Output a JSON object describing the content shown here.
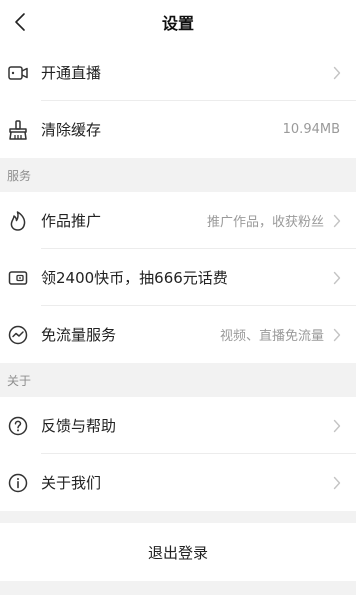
{
  "header": {
    "title": "设置",
    "back_icon": "chevron-left-icon"
  },
  "group_top": [
    {
      "label": "开通直播",
      "icon": "video-camera-icon",
      "value": "",
      "arrow": true
    },
    {
      "label": "清除缓存",
      "icon": "broom-icon",
      "value": "10.94MB",
      "arrow": false
    }
  ],
  "section_services": {
    "title": "服务",
    "items": [
      {
        "label": "作品推广",
        "icon": "flame-icon",
        "value": "推广作品，收获粉丝",
        "arrow": true
      },
      {
        "label": "领2400快币，抽666元话费",
        "icon": "wallet-card-icon",
        "value": "",
        "arrow": true
      },
      {
        "label": "免流量服务",
        "icon": "data-wave-icon",
        "value": "视频、直播免流量",
        "arrow": true
      }
    ]
  },
  "section_about": {
    "title": "关于",
    "items": [
      {
        "label": "反馈与帮助",
        "icon": "help-circle-icon",
        "value": "",
        "arrow": true
      },
      {
        "label": "关于我们",
        "icon": "info-circle-icon",
        "value": "",
        "arrow": true
      }
    ]
  },
  "logout_label": "退出登录",
  "colors": {
    "page_background": "#f2f2f2",
    "row_background": "#ffffff",
    "secondary_text": "#9a9a9a",
    "chevron": "#c4c4c4"
  }
}
